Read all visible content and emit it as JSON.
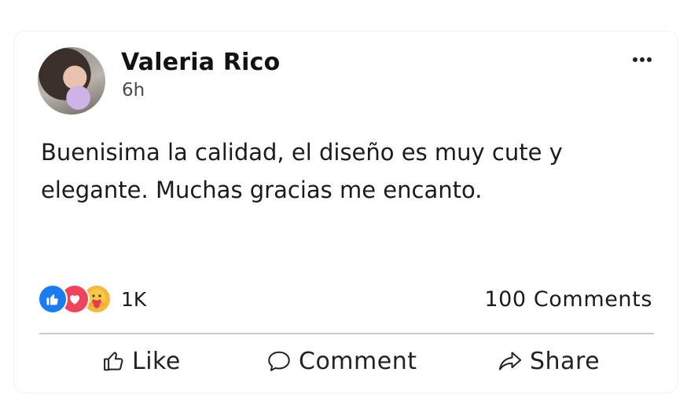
{
  "post": {
    "author": "Valeria Rico",
    "time": "6h",
    "text": "Buenisima la calidad, el diseño es muy cute y elegante. Muchas gracias me encanto.",
    "reactions": {
      "types": [
        "like-icon",
        "love-icon",
        "care-icon"
      ],
      "count": "1K"
    },
    "comments_count": "100",
    "comments_label": "Comments",
    "actions": {
      "like": "Like",
      "comment": "Comment",
      "share": "Share"
    },
    "colors": {
      "like_blue": "#1a7cf2",
      "love_red": "#f0445d",
      "care_yellow": "#f7b73a",
      "divider": "#c5ccd6"
    }
  }
}
